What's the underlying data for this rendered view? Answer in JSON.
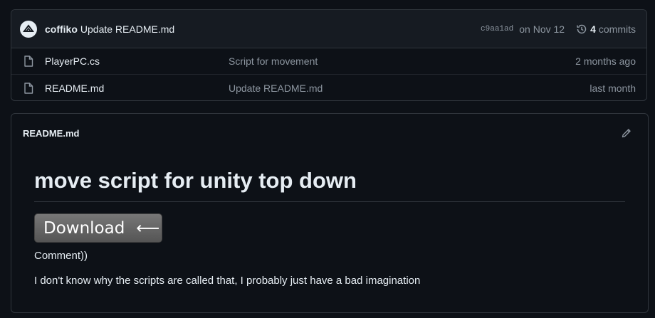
{
  "commit": {
    "author": "coffiko",
    "message": "Update README.md",
    "sha": "c9aa1ad",
    "date": "on Nov 12",
    "count": "4",
    "count_label": "commits"
  },
  "files": [
    {
      "name": "PlayerPC.cs",
      "message": "Script for movement",
      "age": "2 months ago",
      "icon": "file-icon"
    },
    {
      "name": "README.md",
      "message": "Update README.md",
      "age": "last month",
      "icon": "file-icon"
    }
  ],
  "readme": {
    "filename": "README.md",
    "title": "move script for unity top down",
    "download_label": "Download",
    "download_arrow": "⟵",
    "paragraph1": "Comment))",
    "paragraph2": "I don't know why the scripts are called that, I probably just have a bad imagination"
  },
  "colors": {
    "background": "#0d1117",
    "header_bg": "#161b22",
    "border": "#30363d",
    "text": "#e6edf3",
    "muted": "#8d96a0"
  }
}
